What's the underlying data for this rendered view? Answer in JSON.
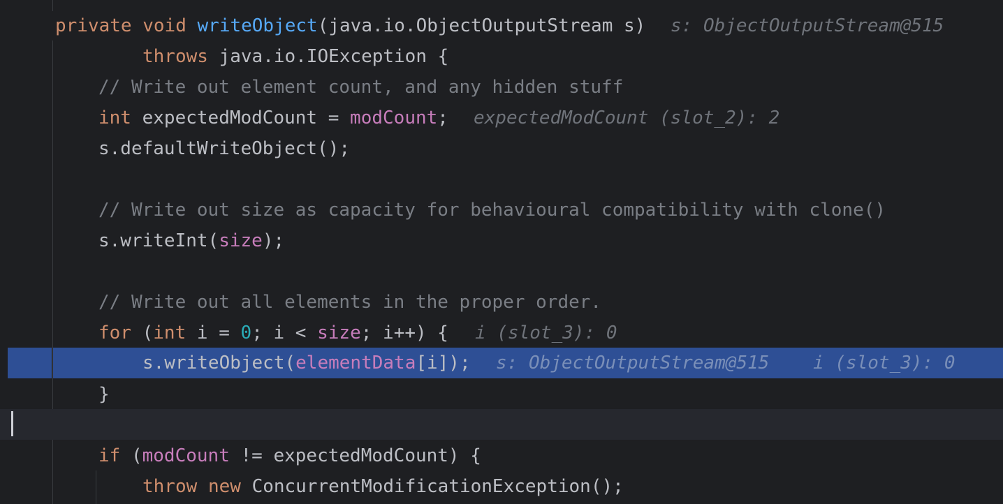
{
  "theme": {
    "editor_bg": "#1e1f22",
    "execution_line_bg": "#2e4f95",
    "current_line_bg": "#26282e",
    "keyword_color": "#cf8e6d",
    "method_color": "#56a8f5",
    "field_color": "#c77dbb",
    "number_color": "#2aacb8",
    "comment_color": "#7a7e85",
    "inline_hint_color": "#6f737a"
  },
  "code": {
    "l1": {
      "kw1": "private",
      "kw2": "void",
      "method": "writeObject",
      "params": "(java.io.ObjectOutputStream s)",
      "hint": "s: ObjectOutputStream@515"
    },
    "l2": {
      "kw": "throws",
      "rest": "java.io.IOException {"
    },
    "l3": {
      "comment": "// Write out element count, and any hidden stuff"
    },
    "l4": {
      "kw": "int",
      "var": "expectedModCount = ",
      "field": "modCount",
      "semi": ";",
      "hint": "expectedModCount (slot_2): 2"
    },
    "l5": {
      "text": "s.defaultWriteObject();"
    },
    "l7": {
      "comment": "// Write out size as capacity for behavioural compatibility with clone()"
    },
    "l8": {
      "pre": "s.writeInt(",
      "field": "size",
      "post": ");"
    },
    "l10": {
      "comment": "// Write out all elements in the proper order."
    },
    "l11": {
      "kw1": "for",
      "p1": " (",
      "kw2": "int",
      "p2": " i = ",
      "num": "0",
      "p3": "; i < ",
      "field": "size",
      "p4": "; i++) {",
      "hint": "i (slot_3): 0"
    },
    "l12": {
      "pre": "s.writeObject(",
      "field": "elementData",
      "post": "[i]);",
      "hint1": "s: ObjectOutputStream@515",
      "hint2": "i (slot_3): 0"
    },
    "l13": {
      "text": "}"
    },
    "l15": {
      "kw": "if",
      "p1": " (",
      "field": "modCount",
      "p2": " != expectedModCount) {"
    },
    "l16": {
      "kw1": "throw",
      "kw2": "new",
      "rest": "ConcurrentModificationException();"
    }
  }
}
